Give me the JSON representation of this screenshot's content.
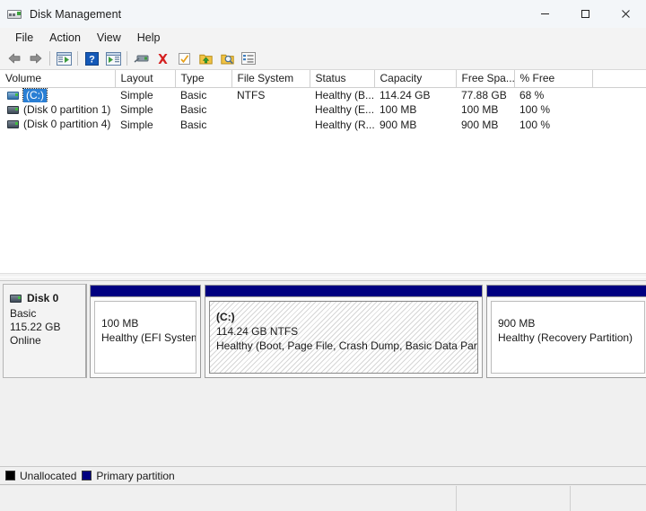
{
  "window": {
    "title": "Disk Management",
    "icon": "disk-drive-icon",
    "controls": {
      "minimize": "–",
      "maximize": "□",
      "close": "✕"
    }
  },
  "menubar": {
    "items": [
      {
        "label": "File"
      },
      {
        "label": "Action"
      },
      {
        "label": "View"
      },
      {
        "label": "Help"
      }
    ]
  },
  "toolbar": {
    "buttons": [
      {
        "name": "back-icon"
      },
      {
        "name": "forward-icon"
      },
      {
        "name": "separator"
      },
      {
        "name": "show-hide-console-tree-icon"
      },
      {
        "name": "separator"
      },
      {
        "name": "help-icon"
      },
      {
        "name": "show-hide-action-pane-icon"
      },
      {
        "name": "separator"
      },
      {
        "name": "rescan-disks-icon"
      },
      {
        "name": "delete-icon"
      },
      {
        "name": "properties-check-icon"
      },
      {
        "name": "export-list-icon"
      },
      {
        "name": "search-folder-icon"
      },
      {
        "name": "properties-list-icon"
      }
    ]
  },
  "volume_list": {
    "columns": [
      {
        "key": "volume",
        "label": "Volume"
      },
      {
        "key": "layout",
        "label": "Layout"
      },
      {
        "key": "type",
        "label": "Type"
      },
      {
        "key": "fs",
        "label": "File System"
      },
      {
        "key": "status",
        "label": "Status"
      },
      {
        "key": "cap",
        "label": "Capacity"
      },
      {
        "key": "free",
        "label": "Free Spa..."
      },
      {
        "key": "pct",
        "label": "% Free"
      },
      {
        "key": "blank",
        "label": ""
      }
    ],
    "rows": [
      {
        "volume": "(C:)",
        "layout": "Simple",
        "type": "Basic",
        "fs": "NTFS",
        "status": "Healthy (B...",
        "cap": "114.24 GB",
        "free": "77.88 GB",
        "pct": "68 %",
        "selected": true,
        "icon": "volume-drive-icon"
      },
      {
        "volume": "(Disk 0 partition 1)",
        "layout": "Simple",
        "type": "Basic",
        "fs": "",
        "status": "Healthy (E...",
        "cap": "100 MB",
        "free": "100 MB",
        "pct": "100 %",
        "selected": false,
        "icon": "volume-drive-icon"
      },
      {
        "volume": "(Disk 0 partition 4)",
        "layout": "Simple",
        "type": "Basic",
        "fs": "",
        "status": "Healthy (R...",
        "cap": "900 MB",
        "free": "900 MB",
        "pct": "100 %",
        "selected": false,
        "icon": "volume-drive-icon"
      }
    ]
  },
  "disk_map": {
    "disk": {
      "name": "Disk 0",
      "type": "Basic",
      "size": "115.22 GB",
      "state": "Online",
      "icon": "disk-drive-icon"
    },
    "partitions": [
      {
        "id": "efi",
        "label": "",
        "size": "100 MB",
        "status": "Healthy (EFI System P",
        "selected": false
      },
      {
        "id": "c",
        "label": "(C:)",
        "size": "114.24 GB NTFS",
        "status": "Healthy (Boot, Page File, Crash Dump, Basic Data Partition)",
        "selected": true
      },
      {
        "id": "recovery",
        "label": "",
        "size": "900 MB",
        "status": "Healthy (Recovery Partition)",
        "selected": false
      }
    ]
  },
  "legend": {
    "items": [
      {
        "label": "Unallocated",
        "color": "#000000"
      },
      {
        "label": "Primary partition",
        "color": "#000080"
      }
    ]
  },
  "statusbar": {
    "cells": [
      "",
      "",
      ""
    ]
  },
  "colors": {
    "primary_partition": "#000080",
    "unallocated": "#000000",
    "selection": "#2a7fd4",
    "window_bg": "#f3f3f3"
  }
}
